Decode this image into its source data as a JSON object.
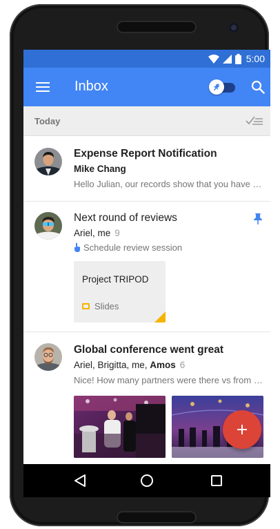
{
  "status_bar": {
    "time": "5:00",
    "icons": [
      "wifi-icon",
      "signal-icon",
      "battery-icon"
    ]
  },
  "app_bar": {
    "title": "Inbox",
    "icons": [
      "menu-icon",
      "pin-toggle",
      "search-icon"
    ]
  },
  "section": {
    "title": "Today",
    "icon": "sweep-done-icon"
  },
  "items": [
    {
      "subject": "Expense Report Notification",
      "sender": "Mike Chang",
      "snippet": "Hello Julian, our records show that you have not submitted your expense report"
    },
    {
      "subject": "Next round of reviews",
      "senders": "Ariel, me",
      "count": "9",
      "reminder": "Schedule review session",
      "pinned": true,
      "attachment": {
        "name": "Project TRIPOD",
        "type": "Slides"
      }
    },
    {
      "subject": "Global conference went great",
      "senders": "Ariel, Brigitta, me, ",
      "senders_bold": "Amos",
      "count": "6",
      "snippet": "Nice! How many partners were there vs from our team?"
    }
  ],
  "fab": {
    "icon": "plus-icon"
  },
  "nav": [
    "back-icon",
    "home-icon",
    "recents-icon"
  ],
  "colors": {
    "primary": "#4285f4",
    "status": "#2f6fd6",
    "fab": "#db4437",
    "pin": "#4285f4",
    "slides": "#f4b400"
  }
}
